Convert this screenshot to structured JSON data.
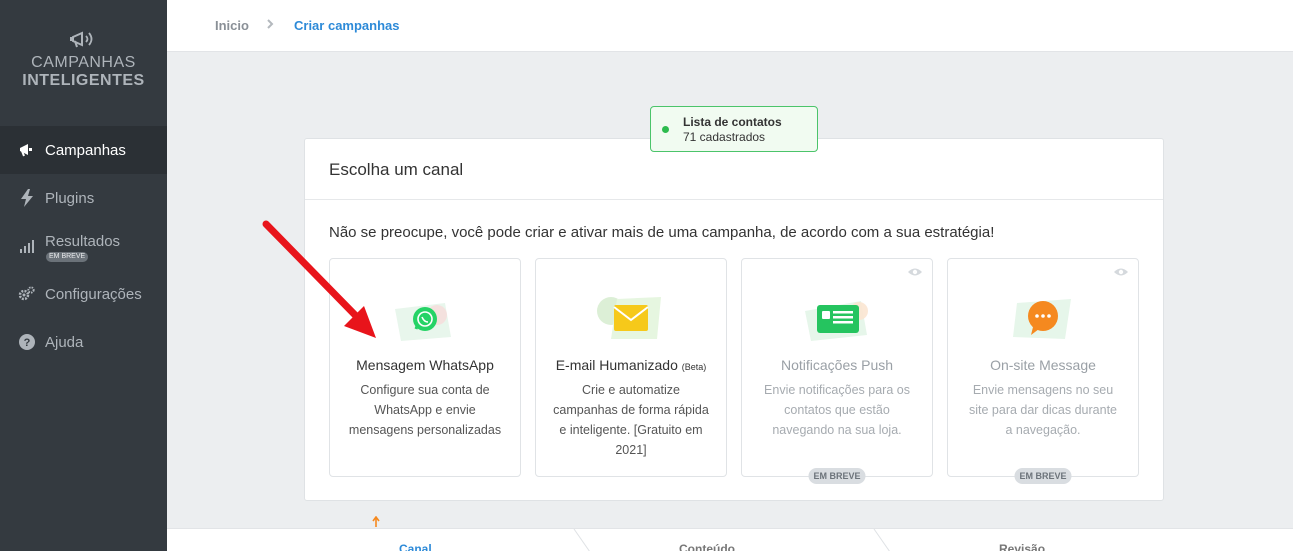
{
  "sidebar": {
    "logo_line1": "CAMPANHAS",
    "logo_line2": "INTELIGENTES",
    "items": [
      {
        "label": "Campanhas",
        "icon": "megaphone-icon",
        "active": true
      },
      {
        "label": "Plugins",
        "icon": "lightning-icon"
      },
      {
        "label": "Resultados",
        "icon": "bar-chart-icon",
        "badge": "EM BREVE"
      },
      {
        "label": "Configurações",
        "icon": "gears-icon"
      },
      {
        "label": "Ajuda",
        "icon": "question-circle-icon"
      }
    ]
  },
  "breadcrumb": {
    "home": "Inicio",
    "separator": ">",
    "current": "Criar campanhas"
  },
  "contacts": {
    "title": "Lista de contatos",
    "count": "71 cadastrados"
  },
  "card": {
    "heading": "Escolha um canal",
    "description": "Não se preocupe, você pode criar e ativar mais de uma campanha, de acordo com a sua estratégia!",
    "options": [
      {
        "title": "Mensagem WhatsApp",
        "desc": "Configure sua conta de WhatsApp e envie mensagens personalizadas",
        "icon": "whatsapp-icon"
      },
      {
        "title": "E-mail Humanizado",
        "beta": "(Beta)",
        "desc": "Crie e automatize campanhas de forma rápida e inteligente. [Gratuito em 2021]",
        "icon": "envelope-icon"
      },
      {
        "title": "Notificações Push",
        "desc": "Envie notificações para os contatos que estão navegando na sua loja.",
        "soon": "EM BREVE",
        "icon": "notification-card-icon"
      },
      {
        "title": "On-site Message",
        "desc": "Envie mensagens no seu site para dar dicas durante a navegação.",
        "soon": "EM BREVE",
        "icon": "chat-bubble-icon"
      }
    ]
  },
  "steps": [
    "Canal",
    "Conteúdo",
    "Revisão"
  ],
  "colors": {
    "sidebar": "#343a40",
    "accent": "#2d8ad8",
    "success": "#2dbb4e",
    "whatsapp": "#25d366",
    "envelope": "#f6c91a",
    "push": "#25c45f",
    "onsite": "#f5891f",
    "arrow": "#e8141b"
  }
}
